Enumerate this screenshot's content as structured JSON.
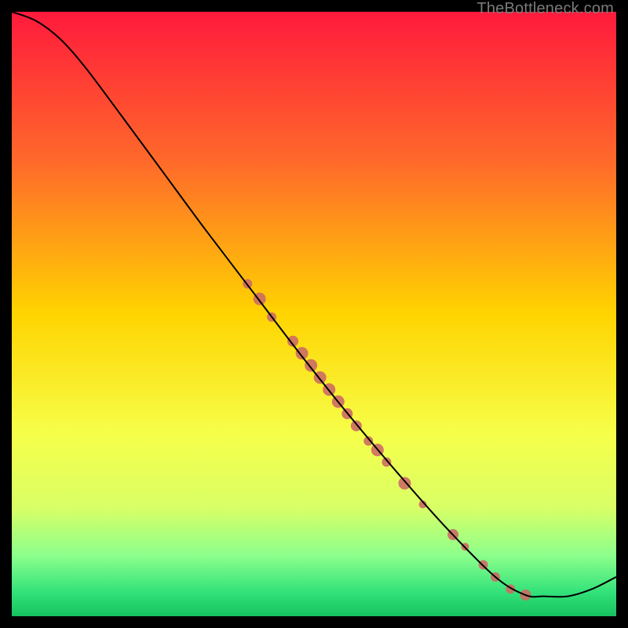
{
  "watermark": "TheBottleneck.com",
  "chart_data": {
    "type": "line",
    "title": "",
    "xlabel": "",
    "ylabel": "",
    "xlim": [
      0,
      100
    ],
    "ylim": [
      0,
      100
    ],
    "gradient_stops": [
      {
        "offset": 0,
        "color": "#ff1a3c"
      },
      {
        "offset": 0.25,
        "color": "#ff6a2a"
      },
      {
        "offset": 0.5,
        "color": "#ffd400"
      },
      {
        "offset": 0.7,
        "color": "#f6ff4a"
      },
      {
        "offset": 0.82,
        "color": "#d9ff66"
      },
      {
        "offset": 0.9,
        "color": "#8cff8c"
      },
      {
        "offset": 0.96,
        "color": "#33e27a"
      },
      {
        "offset": 1.0,
        "color": "#16c25e"
      }
    ],
    "curve": [
      {
        "x": 0,
        "y": 100
      },
      {
        "x": 4,
        "y": 98.5
      },
      {
        "x": 8,
        "y": 95.5
      },
      {
        "x": 12,
        "y": 91
      },
      {
        "x": 18,
        "y": 83
      },
      {
        "x": 25,
        "y": 73.5
      },
      {
        "x": 32,
        "y": 64
      },
      {
        "x": 40,
        "y": 53.5
      },
      {
        "x": 48,
        "y": 43
      },
      {
        "x": 56,
        "y": 33
      },
      {
        "x": 64,
        "y": 23.5
      },
      {
        "x": 72,
        "y": 14.5
      },
      {
        "x": 80,
        "y": 6.5
      },
      {
        "x": 85,
        "y": 3.5
      },
      {
        "x": 88,
        "y": 3.3
      },
      {
        "x": 92,
        "y": 3.3
      },
      {
        "x": 96,
        "y": 4.5
      },
      {
        "x": 100,
        "y": 6.5
      }
    ],
    "points": [
      {
        "x": 39.0,
        "y": 55.0,
        "r": 6
      },
      {
        "x": 41.0,
        "y": 52.5,
        "r": 8
      },
      {
        "x": 43.0,
        "y": 49.5,
        "r": 6
      },
      {
        "x": 46.5,
        "y": 45.5,
        "r": 7
      },
      {
        "x": 48.0,
        "y": 43.5,
        "r": 8
      },
      {
        "x": 49.5,
        "y": 41.5,
        "r": 8
      },
      {
        "x": 51.0,
        "y": 39.5,
        "r": 8
      },
      {
        "x": 52.5,
        "y": 37.5,
        "r": 8
      },
      {
        "x": 54.0,
        "y": 35.5,
        "r": 8
      },
      {
        "x": 55.5,
        "y": 33.5,
        "r": 7
      },
      {
        "x": 57.0,
        "y": 31.5,
        "r": 7
      },
      {
        "x": 59.0,
        "y": 29.0,
        "r": 6
      },
      {
        "x": 60.5,
        "y": 27.5,
        "r": 8
      },
      {
        "x": 62.0,
        "y": 25.5,
        "r": 6
      },
      {
        "x": 65.0,
        "y": 22.0,
        "r": 8
      },
      {
        "x": 68.0,
        "y": 18.5,
        "r": 5
      },
      {
        "x": 73.0,
        "y": 13.5,
        "r": 7
      },
      {
        "x": 75.0,
        "y": 11.5,
        "r": 5
      },
      {
        "x": 78.0,
        "y": 8.5,
        "r": 6
      },
      {
        "x": 80.0,
        "y": 6.5,
        "r": 6
      },
      {
        "x": 82.5,
        "y": 4.5,
        "r": 6
      },
      {
        "x": 85.0,
        "y": 3.5,
        "r": 7
      }
    ],
    "point_color": "#cc6b63",
    "curve_color": "#000000"
  }
}
